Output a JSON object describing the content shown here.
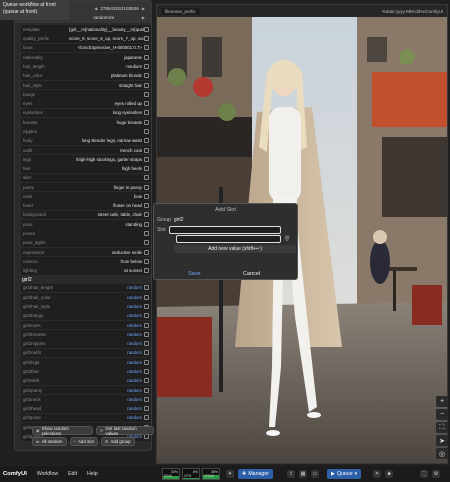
{
  "tooltip": "Queue workflow at front (queue at front)",
  "node": {
    "seed_value": "2795432S21S0636",
    "control": "randomize",
    "rows": [
      {
        "k": "template",
        "v": "{girl__m{nationality}__beauty__m{quality__"
      },
      {
        "k": "quality_prefix",
        "v": "score_9, score_8_up, score_7_up, sour"
      },
      {
        "k": "loras",
        "v": "<lora:Expressive_H-000001:0.7>"
      },
      {
        "k": "nationality",
        "v": "japanese"
      },
      {
        "k": "hair_length",
        "v": "medium"
      },
      {
        "k": "hair_color",
        "v": "platinum blonde"
      },
      {
        "k": "hair_style",
        "v": "straight hair"
      },
      {
        "k": "bangs",
        "v": ""
      },
      {
        "k": "eyes",
        "v": "eyes rolled up"
      },
      {
        "k": "eyelashes",
        "v": "long eyelashes"
      },
      {
        "k": "breasts",
        "v": "huge breasts"
      },
      {
        "k": "nipples",
        "v": ""
      },
      {
        "k": "body",
        "v": "long slender legs, narrow waist"
      },
      {
        "k": "outfit",
        "v": "trench coat"
      },
      {
        "k": "legs",
        "v": "thigh-high stockings, garter straps"
      },
      {
        "k": "feet",
        "v": "high heels"
      },
      {
        "k": "skirt",
        "v": ""
      },
      {
        "k": "panty",
        "v": "finger in pussy"
      },
      {
        "k": "neck",
        "v": "bow"
      },
      {
        "k": "head",
        "v": "flower on head"
      },
      {
        "k": "background",
        "v": "street cafe, table, chair"
      },
      {
        "k": "pose",
        "v": "standing"
      },
      {
        "k": "pose2",
        "v": ""
      },
      {
        "k": "pose_2girls",
        "v": ""
      },
      {
        "k": "expression",
        "v": "seductive smile"
      },
      {
        "k": "camera",
        "v": "from below"
      },
      {
        "k": "lighting",
        "v": "at sunset"
      }
    ],
    "group_label": "girl2",
    "random_rows": [
      {
        "k": "girl2hair_length",
        "v": "random"
      },
      {
        "k": "girl2hair_color",
        "v": "random"
      },
      {
        "k": "girl2hair_style",
        "v": "random"
      },
      {
        "k": "girl2bangs",
        "v": "random"
      },
      {
        "k": "girl2eyes",
        "v": "random"
      },
      {
        "k": "girl2breasts",
        "v": "random"
      },
      {
        "k": "girl2nipples",
        "v": "random"
      },
      {
        "k": "girl2outfit",
        "v": "random"
      },
      {
        "k": "girl2legs",
        "v": "random"
      },
      {
        "k": "girl2feet",
        "v": "random"
      },
      {
        "k": "girl2skirt",
        "v": "random"
      },
      {
        "k": "girl2panty",
        "v": "random"
      },
      {
        "k": "girl2neck",
        "v": "random"
      },
      {
        "k": "girl2head",
        "v": "random"
      },
      {
        "k": "girl2pose",
        "v": "random"
      },
      {
        "k": "girl2expression",
        "v": "random"
      },
      {
        "k": "girl2pose2",
        "v": "random"
      }
    ],
    "btn_show_random": "Show random selections",
    "btn_get_last": "Get last random values",
    "btn_all_random": "All random",
    "btn_add_slot": "Add slot",
    "btn_add_group": "Add group"
  },
  "image": {
    "filename_prefix": "filename_prefix",
    "date_prefix": "%date:yyyy-MM-dd%/ComfyUI"
  },
  "dialog": {
    "title": "Add Slot",
    "group_label": "Group",
    "group_value": "girl2",
    "slot_label": "Slot",
    "add_value": "Add new value (shift+↵)",
    "save": "Save",
    "cancel": "Cancel"
  },
  "bar": {
    "logo": "ComfyUI",
    "menu": [
      "Workflow",
      "Edit",
      "Help"
    ],
    "ram_label": "RAM",
    "ram_value": "30%",
    "ram_level": 0.3,
    "cpu_label": "CPU",
    "cpu_value": "6%",
    "cpu_level": 0.06,
    "vram_label": "VRAM",
    "vram_value": "36%",
    "vram_level": 0.36,
    "manager": "Manager",
    "queue": "Queue"
  },
  "colors": {
    "accent": "#2c5fa8",
    "random": "#6fa8ff"
  }
}
